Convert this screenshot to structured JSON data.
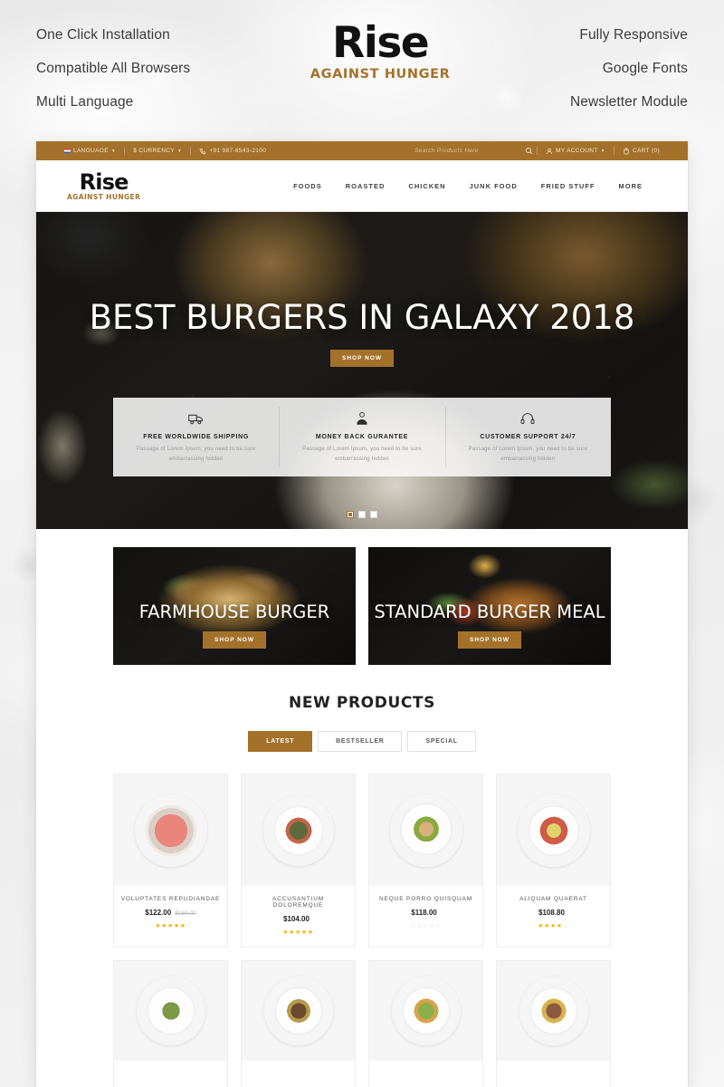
{
  "promo": {
    "left_features": [
      "One Click Installation",
      "Compatible All Browsers",
      "Multi Language"
    ],
    "right_features": [
      "Fully Responsive",
      "Google Fonts",
      "Newsletter Module"
    ],
    "logo": {
      "word": "Rise",
      "tagline": "AGAINST HUNGER"
    }
  },
  "colors": {
    "gold": "#a4712a",
    "star": "#f4b400",
    "dark": "#151412"
  },
  "topbar": {
    "language": "LANGUAGE",
    "currency": "$ CURRENCY",
    "phone": "+91 987-6543-2100",
    "search_placeholder": "Search Products Here",
    "account": "MY ACCOUNT",
    "cart": "CART (0)"
  },
  "header": {
    "logo": {
      "word": "Rise",
      "tagline": "AGAINST HUNGER"
    },
    "nav": [
      "FOODS",
      "ROASTED",
      "CHICKEN",
      "JUNK FOOD",
      "FRIED STUFF",
      "MORE"
    ]
  },
  "hero": {
    "title": "BEST BURGERS IN GALAXY 2018",
    "cta": "SHOP NOW",
    "slide_count": 3,
    "active_slide": 1
  },
  "services": [
    {
      "icon": "shipping-truck-icon",
      "title": "FREE WORLDWIDE SHIPPING",
      "line1": "Passage of Lorem Ipsum, you need to be sure",
      "line2": "embarrassing hidden"
    },
    {
      "icon": "money-back-person-icon",
      "title": "MONEY BACK GURANTEE",
      "line1": "Passage of Lorem Ipsum, you need to be sure",
      "line2": "embarrassing hidden"
    },
    {
      "icon": "customer-support-headset-icon",
      "title": "CUSTOMER SUPPORT 24/7",
      "line1": "Passage of Lorem Ipsum, you need to be sure",
      "line2": "embarrassing hidden"
    }
  ],
  "banners": [
    {
      "title": "FARMHOUSE BURGER",
      "cta": "SHOP NOW"
    },
    {
      "title": "STANDARD BURGER MEAL",
      "cta": "SHOP NOW"
    }
  ],
  "products_section": {
    "title": "NEW PRODUCTS",
    "tabs": [
      {
        "label": "LATEST",
        "active": true
      },
      {
        "label": "BESTSELLER",
        "active": false
      },
      {
        "label": "SPECIAL",
        "active": false
      }
    ]
  },
  "products_row1": [
    {
      "name": "VOLUPTATES REPUDIANDAE",
      "price": "$122.00",
      "old_price": "$160.00",
      "rating": 5
    },
    {
      "name": "ACCUSANTIUM DOLOREMQUE",
      "price": "$104.00",
      "old_price": "",
      "rating": 5
    },
    {
      "name": "NEQUE PORRO QUISQUAM",
      "price": "$118.00",
      "old_price": "",
      "rating": 0
    },
    {
      "name": "ALIQUAM QUAERAT",
      "price": "$108.80",
      "old_price": "",
      "rating": 4
    }
  ],
  "products_row2": [
    {
      "name": "",
      "price": "",
      "old_price": "",
      "rating": 0
    },
    {
      "name": "",
      "price": "",
      "old_price": "",
      "rating": 0
    },
    {
      "name": "",
      "price": "",
      "old_price": "",
      "rating": 0
    },
    {
      "name": "",
      "price": "",
      "old_price": "",
      "rating": 0
    }
  ]
}
